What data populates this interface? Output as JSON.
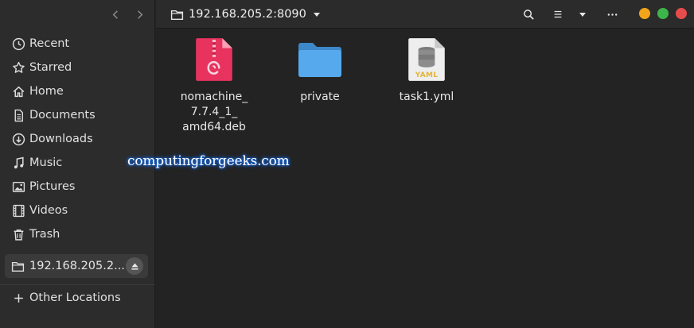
{
  "header": {
    "path": "192.168.205.2:8090"
  },
  "sidebar": {
    "items": [
      {
        "label": "Recent",
        "icon": "clock-icon"
      },
      {
        "label": "Starred",
        "icon": "star-icon"
      },
      {
        "label": "Home",
        "icon": "home-icon"
      },
      {
        "label": "Documents",
        "icon": "document-icon"
      },
      {
        "label": "Downloads",
        "icon": "download-icon"
      },
      {
        "label": "Music",
        "icon": "music-icon"
      },
      {
        "label": "Pictures",
        "icon": "picture-icon"
      },
      {
        "label": "Videos",
        "icon": "video-icon"
      },
      {
        "label": "Trash",
        "icon": "trash-icon"
      }
    ],
    "mount": {
      "label": "192.168.205.2..."
    },
    "other_locations": "Other Locations"
  },
  "files": [
    {
      "name": "nomachine_\n7.7.4_1_\namd64.deb",
      "icon": "deb-package-icon"
    },
    {
      "name": "private",
      "icon": "folder-icon"
    },
    {
      "name": "task1.yml",
      "icon": "yaml-file-icon"
    }
  ],
  "watermark": "computingforgeeks.com",
  "colors": {
    "sidebar_bg": "#2c2c2c",
    "content_bg": "#232323",
    "folder": "#4a9fe0",
    "deb": "#e8335f",
    "close": "#e74c4c",
    "maximize": "#3db54a",
    "minimize": "#f2a51a"
  }
}
